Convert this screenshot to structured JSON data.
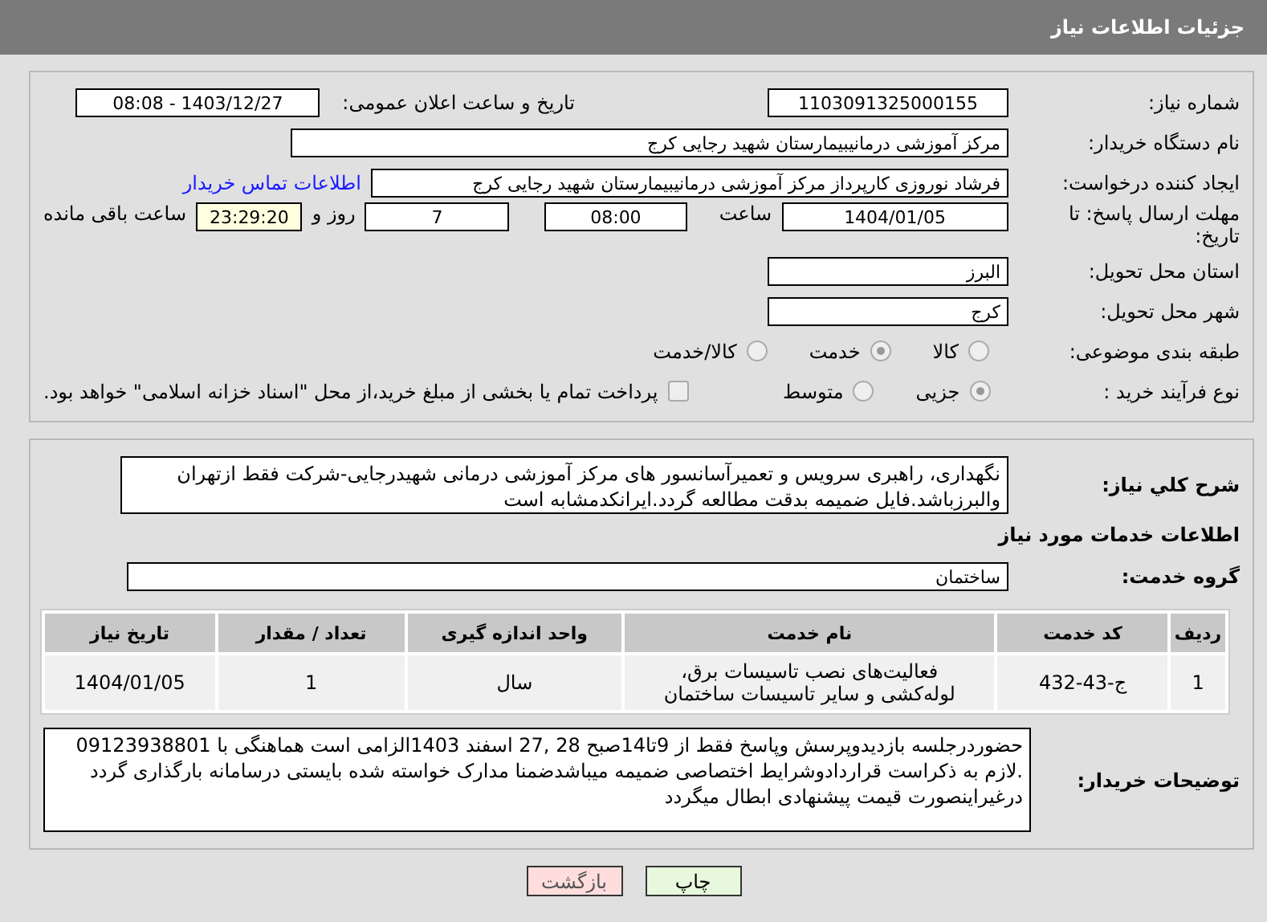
{
  "header": {
    "title": "جزئیات اطلاعات نیاز"
  },
  "need_number": {
    "label": "شماره نیاز:",
    "value": "1103091325000155"
  },
  "announce": {
    "label": "تاریخ و ساعت اعلان عمومی:",
    "value": "1403/12/27 - 08:08"
  },
  "buyer_org": {
    "label": "نام دستگاه خریدار:",
    "value": "مرکز آموزشی درمانیبیمارستان شهید رجایی کرج"
  },
  "requester": {
    "label": "ایجاد کننده درخواست:",
    "value": "فرشاد نوروزی کارپرداز مرکز آموزشی درمانیبیمارستان شهید رجایی کرج",
    "link": "اطلاعات تماس خریدار"
  },
  "deadline": {
    "label": "مهلت ارسال پاسخ: تا تاریخ:",
    "date": "1404/01/05",
    "time_label": "ساعت",
    "time": "08:00",
    "days": "7",
    "days_label": "روز و",
    "remaining": "23:29:20",
    "remaining_label": "ساعت باقی مانده"
  },
  "province": {
    "label": "استان محل تحویل:",
    "value": "البرز"
  },
  "city": {
    "label": "شهر محل تحویل:",
    "value": "کرج"
  },
  "category": {
    "label": "طبقه بندی موضوعی:",
    "options": [
      {
        "label": "کالا",
        "selected": false
      },
      {
        "label": "خدمت",
        "selected": true
      },
      {
        "label": "کالا/خدمت",
        "selected": false
      }
    ]
  },
  "process": {
    "label": "نوع فرآیند خرید :",
    "options": [
      {
        "label": "جزیی",
        "selected": true
      },
      {
        "label": "متوسط",
        "selected": false
      }
    ],
    "payment": {
      "label": "پرداخت تمام یا بخشی از مبلغ خرید،از محل \"اسناد خزانه اسلامی\" خواهد بود.",
      "checked": false
    }
  },
  "description": {
    "label": "شرح كلي نیاز:",
    "value": "نگهداری، راهبری سرویس و تعمیرآسانسور های مرکز آموزشی درمانی شهیدرجایی-شرکت فقط ازتهران والبرزباشد.فایل ضمیمه بدقت مطالعه گردد.ایرانکدمشابه است"
  },
  "services_heading": "اطلاعات خدمات مورد نیاز",
  "service_group": {
    "label": "گروه خدمت:",
    "value": "ساختمان"
  },
  "table": {
    "columns": [
      "ردیف",
      "کد خدمت",
      "نام خدمت",
      "واحد اندازه گیری",
      "تعداد / مقدار",
      "تاریخ نیاز"
    ],
    "rows": [
      [
        "1",
        "ج-43-432",
        "فعالیت‌های نصب تاسیسات برق، لوله‌کشی و سایر تاسیسات ساختمان",
        "سال",
        "1",
        "1404/01/05"
      ]
    ]
  },
  "buyer_notes": {
    "label": "توضیحات خریدار:",
    "value": "حضوردرجلسه بازدیدوپرسش وپاسخ فقط از 9تا14صبح 28 ,27 اسفند 1403الزامی است هماهنگی با  09123938801  .لازم به ذکراست قراردادوشرایط اختصاصی ضمیمه میباشدضمنا مدارک خواسته شده بایستی درسامانه بارگذاری گردد درغیراینصورت قیمت پیشنهادی ابطال میگردد"
  },
  "buttons": [
    {
      "label": "چاپ",
      "kind": "print"
    },
    {
      "label": "بازگشت",
      "kind": "back"
    }
  ]
}
